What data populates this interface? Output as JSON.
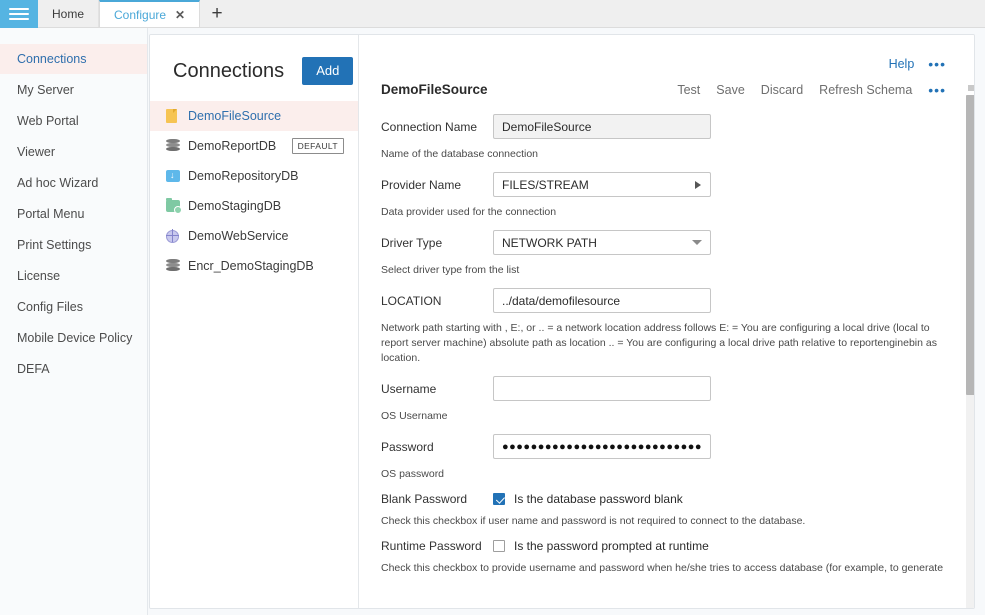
{
  "tabbar": {
    "menu_icon": "hamburger-icon",
    "tabs": [
      {
        "label": "Home",
        "active": false,
        "closable": false
      },
      {
        "label": "Configure",
        "active": true,
        "closable": true,
        "close_glyph": "✕"
      }
    ],
    "add_tab_glyph": "+"
  },
  "sidebar": {
    "items": [
      {
        "label": "Connections",
        "active": true
      },
      {
        "label": "My Server",
        "active": false
      },
      {
        "label": "Web Portal",
        "active": false
      },
      {
        "label": "Viewer",
        "active": false
      },
      {
        "label": "Ad hoc Wizard",
        "active": false
      },
      {
        "label": "Portal Menu",
        "active": false
      },
      {
        "label": "Print Settings",
        "active": false
      },
      {
        "label": "License",
        "active": false
      },
      {
        "label": "Config Files",
        "active": false
      },
      {
        "label": "Mobile Device Policy",
        "active": false
      },
      {
        "label": "DEFA",
        "active": false
      }
    ]
  },
  "connections_panel": {
    "title": "Connections",
    "add_label": "Add",
    "items": [
      {
        "label": "DemoFileSource",
        "icon": "file-icon",
        "active": true,
        "badge": ""
      },
      {
        "label": "DemoReportDB",
        "icon": "database-icon",
        "active": false,
        "badge": "DEFAULT"
      },
      {
        "label": "DemoRepositoryDB",
        "icon": "folder-download-icon",
        "active": false,
        "badge": ""
      },
      {
        "label": "DemoStagingDB",
        "icon": "folder-gear-icon",
        "active": false,
        "badge": ""
      },
      {
        "label": "DemoWebService",
        "icon": "globe-icon",
        "active": false,
        "badge": ""
      },
      {
        "label": "Encr_DemoStagingDB",
        "icon": "database-icon",
        "active": false,
        "badge": ""
      }
    ]
  },
  "detail": {
    "help_label": "Help",
    "top_overflow_glyph": "•••",
    "title": "DemoFileSource",
    "actions": [
      {
        "label": "Test"
      },
      {
        "label": "Save"
      },
      {
        "label": "Discard"
      },
      {
        "label": "Refresh Schema"
      }
    ],
    "actions_overflow_glyph": "•••",
    "fields": {
      "connection_name": {
        "label": "Connection Name",
        "value": "DemoFileSource",
        "placeholder": "",
        "help": "Name of the database connection"
      },
      "provider_name": {
        "label": "Provider Name",
        "value": "FILES/STREAM",
        "help": "Data provider used for the connection"
      },
      "driver_type": {
        "label": "Driver Type",
        "value": "NETWORK PATH",
        "help": "Select driver type from the list"
      },
      "location": {
        "label": "LOCATION",
        "value": "../data/demofilesource",
        "placeholder": "",
        "help": "Network path starting with , E:, or .. = a network location address follows E: = You are configuring a local drive (local to report server machine) absolute path as location .. = You are configuring a local drive path relative to reportenginebin as location."
      },
      "username": {
        "label": "Username",
        "value": "",
        "placeholder": "",
        "help": "OS Username"
      },
      "password": {
        "label": "Password",
        "value": "●●●●●●●●●●●●●●●●●●●●●●●●●●●●●●●●●●",
        "help": "OS password"
      },
      "blank_password": {
        "label": "Blank Password",
        "checkbox_label": "Is the database password blank",
        "checked": true,
        "help": "Check this checkbox if user name and password is not required to connect to the database."
      },
      "runtime_password": {
        "label": "Runtime Password",
        "checkbox_label": "Is the password prompted at runtime",
        "checked": false,
        "help": "Check this checkbox to provide username and password when he/she tries to access database (for example, to generate a report"
      }
    }
  },
  "colors": {
    "accent_blue": "#2272b6",
    "hamburger_blue": "#55b4e2",
    "tab_active_blue": "#4aa8d8",
    "active_row_bg": "#fbeeec",
    "link_blue": "#2f6fad"
  }
}
